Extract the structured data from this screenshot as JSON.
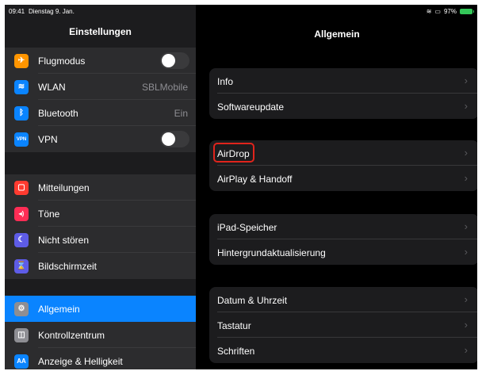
{
  "status_bar": {
    "time": "09:41",
    "date": "Dienstag 9. Jan.",
    "battery": "97%"
  },
  "sidebar": {
    "title": "Einstellungen",
    "group1": [
      {
        "label": "Flugmodus",
        "icon": "airplane-icon",
        "icon_glyph": "✈",
        "color": "#ff9500",
        "toggle": "off"
      },
      {
        "label": "WLAN",
        "value": "SBLMobile",
        "icon": "wifi-icon",
        "icon_glyph": "≋",
        "color": "#0a84ff"
      },
      {
        "label": "Bluetooth",
        "value": "Ein",
        "icon": "bluetooth-icon",
        "icon_glyph": "ᛒ",
        "color": "#0a84ff"
      },
      {
        "label": "VPN",
        "icon": "vpn-icon",
        "icon_glyph": "VPN",
        "color": "#0a84ff",
        "toggle": "off"
      }
    ],
    "group2": [
      {
        "label": "Mitteilungen",
        "icon": "notifications-icon",
        "icon_glyph": "▢",
        "color": "#ff3b30"
      },
      {
        "label": "Töne",
        "icon": "sounds-icon",
        "icon_glyph": "◂)",
        "color": "#ff2d55"
      },
      {
        "label": "Nicht stören",
        "icon": "moon-icon",
        "icon_glyph": "☾",
        "color": "#5e5ce6"
      },
      {
        "label": "Bildschirmzeit",
        "icon": "hourglass-icon",
        "icon_glyph": "⌛",
        "color": "#5e5ce6"
      }
    ],
    "group3": [
      {
        "label": "Allgemein",
        "icon": "gear-icon",
        "icon_glyph": "⚙",
        "color": "#8e8e93",
        "active": true
      },
      {
        "label": "Kontrollzentrum",
        "icon": "control-center-icon",
        "icon_glyph": "◫",
        "color": "#8e8e93"
      },
      {
        "label": "Anzeige & Helligkeit",
        "icon": "display-icon",
        "icon_glyph": "AA",
        "color": "#0a84ff"
      }
    ]
  },
  "main": {
    "title": "Allgemein",
    "groups": [
      [
        "Info",
        "Softwareupdate"
      ],
      [
        "AirDrop",
        "AirPlay & Handoff"
      ],
      [
        "iPad-Speicher",
        "Hintergrundaktualisierung"
      ],
      [
        "Datum & Uhrzeit",
        "Tastatur",
        "Schriften"
      ]
    ],
    "highlighted": "AirDrop",
    "highlight_color": "#e0241c"
  }
}
